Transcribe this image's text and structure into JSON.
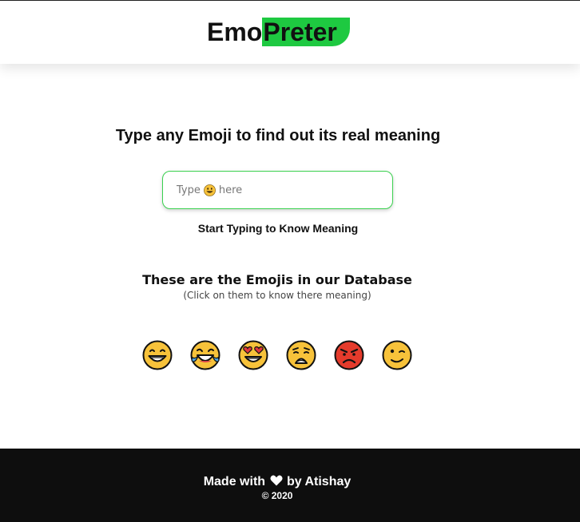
{
  "header": {
    "logo_part1": "Emo",
    "logo_part2": "Preter",
    "accent_color": "#1ec941"
  },
  "main": {
    "heading": "Type any Emoji to find out its real meaning",
    "input": {
      "placeholder_before": "Type",
      "placeholder_icon": "grinning-face-icon",
      "placeholder_after": "here"
    },
    "meaning_text": "Start Typing to Know Meaning",
    "database_title": "These are the Emojis in our Database",
    "database_subtitle": "(Click on them to know there meaning)",
    "emojis": [
      {
        "icon": "grinning-face-icon"
      },
      {
        "icon": "tears-of-joy-icon"
      },
      {
        "icon": "heart-eyes-icon"
      },
      {
        "icon": "weary-face-icon"
      },
      {
        "icon": "angry-face-icon"
      },
      {
        "icon": "winking-face-icon"
      }
    ]
  },
  "footer": {
    "made_with": "Made with",
    "heart_icon": "heart-icon",
    "by_author": "by Atishay",
    "copyright": "© 2020"
  }
}
